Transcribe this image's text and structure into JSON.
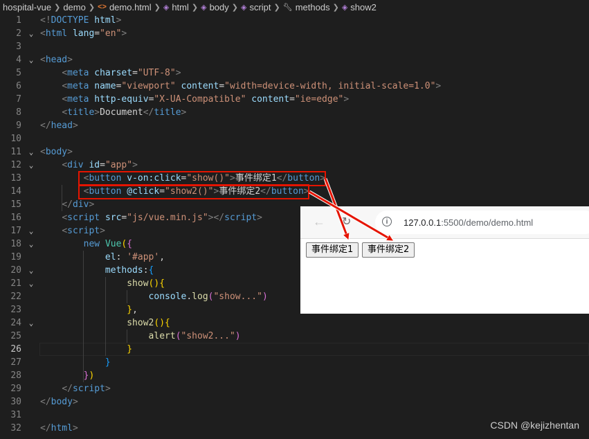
{
  "breadcrumb": [
    "hospital-vue",
    "demo",
    "demo.html",
    "html",
    "body",
    "script",
    "methods",
    "show2"
  ],
  "editor": {
    "active_line": 26,
    "lines": [
      {
        "n": 1,
        "fold": "",
        "segs": [
          [
            "br",
            "<!"
          ],
          [
            "tag",
            "DOCTYPE"
          ],
          [
            "txt",
            " "
          ],
          [
            "attr",
            "html"
          ],
          [
            "br",
            ">"
          ]
        ]
      },
      {
        "n": 2,
        "fold": "v",
        "segs": [
          [
            "br",
            "<"
          ],
          [
            "tag",
            "html"
          ],
          [
            "txt",
            " "
          ],
          [
            "attr",
            "lang"
          ],
          [
            "txt",
            "="
          ],
          [
            "str",
            "\"en\""
          ],
          [
            "br",
            ">"
          ]
        ]
      },
      {
        "n": 3,
        "fold": "",
        "segs": []
      },
      {
        "n": 4,
        "fold": "v",
        "segs": [
          [
            "br",
            "<"
          ],
          [
            "tag",
            "head"
          ],
          [
            "br",
            ">"
          ]
        ]
      },
      {
        "n": 5,
        "fold": "",
        "segs": [
          [
            "txt",
            "    "
          ],
          [
            "br",
            "<"
          ],
          [
            "tag",
            "meta"
          ],
          [
            "txt",
            " "
          ],
          [
            "attr",
            "charset"
          ],
          [
            "txt",
            "="
          ],
          [
            "str",
            "\"UTF-8\""
          ],
          [
            "br",
            ">"
          ]
        ]
      },
      {
        "n": 6,
        "fold": "",
        "segs": [
          [
            "txt",
            "    "
          ],
          [
            "br",
            "<"
          ],
          [
            "tag",
            "meta"
          ],
          [
            "txt",
            " "
          ],
          [
            "attr",
            "name"
          ],
          [
            "txt",
            "="
          ],
          [
            "str",
            "\"viewport\""
          ],
          [
            "txt",
            " "
          ],
          [
            "attr",
            "content"
          ],
          [
            "txt",
            "="
          ],
          [
            "str",
            "\"width=device-width, initial-scale=1.0\""
          ],
          [
            "br",
            ">"
          ]
        ]
      },
      {
        "n": 7,
        "fold": "",
        "segs": [
          [
            "txt",
            "    "
          ],
          [
            "br",
            "<"
          ],
          [
            "tag",
            "meta"
          ],
          [
            "txt",
            " "
          ],
          [
            "attr",
            "http-equiv"
          ],
          [
            "txt",
            "="
          ],
          [
            "str",
            "\"X-UA-Compatible\""
          ],
          [
            "txt",
            " "
          ],
          [
            "attr",
            "content"
          ],
          [
            "txt",
            "="
          ],
          [
            "str",
            "\"ie=edge\""
          ],
          [
            "br",
            ">"
          ]
        ]
      },
      {
        "n": 8,
        "fold": "",
        "segs": [
          [
            "txt",
            "    "
          ],
          [
            "br",
            "<"
          ],
          [
            "tag",
            "title"
          ],
          [
            "br",
            ">"
          ],
          [
            "txt",
            "Document"
          ],
          [
            "br",
            "</"
          ],
          [
            "tag",
            "title"
          ],
          [
            "br",
            ">"
          ]
        ]
      },
      {
        "n": 9,
        "fold": "",
        "segs": [
          [
            "br",
            "</"
          ],
          [
            "tag",
            "head"
          ],
          [
            "br",
            ">"
          ]
        ]
      },
      {
        "n": 10,
        "fold": "",
        "segs": []
      },
      {
        "n": 11,
        "fold": "v",
        "segs": [
          [
            "br",
            "<"
          ],
          [
            "tag",
            "body"
          ],
          [
            "br",
            ">"
          ]
        ]
      },
      {
        "n": 12,
        "fold": "v",
        "segs": [
          [
            "txt",
            "    "
          ],
          [
            "br",
            "<"
          ],
          [
            "tag",
            "div"
          ],
          [
            "txt",
            " "
          ],
          [
            "attr",
            "id"
          ],
          [
            "txt",
            "="
          ],
          [
            "str",
            "\"app\""
          ],
          [
            "br",
            ">"
          ]
        ]
      },
      {
        "n": 13,
        "fold": "",
        "segs": [
          [
            "txt",
            "        "
          ],
          [
            "br",
            "<"
          ],
          [
            "tag",
            "button"
          ],
          [
            "txt",
            " "
          ],
          [
            "attr",
            "v-on:click"
          ],
          [
            "txt",
            "="
          ],
          [
            "str",
            "\"show()\""
          ],
          [
            "br",
            ">"
          ],
          [
            "txt",
            "事件绑定1"
          ],
          [
            "br",
            "</"
          ],
          [
            "tag",
            "button"
          ],
          [
            "br",
            ">"
          ]
        ]
      },
      {
        "n": 14,
        "fold": "",
        "segs": [
          [
            "txt",
            "        "
          ],
          [
            "br",
            "<"
          ],
          [
            "tag",
            "button"
          ],
          [
            "txt",
            " "
          ],
          [
            "attr",
            "@click"
          ],
          [
            "txt",
            "="
          ],
          [
            "str",
            "\"show2()\""
          ],
          [
            "br",
            ">"
          ],
          [
            "txt",
            "事件绑定2"
          ],
          [
            "br",
            "</"
          ],
          [
            "tag",
            "button"
          ],
          [
            "br",
            ">"
          ]
        ]
      },
      {
        "n": 15,
        "fold": "",
        "segs": [
          [
            "txt",
            "    "
          ],
          [
            "br",
            "</"
          ],
          [
            "tag",
            "div"
          ],
          [
            "br",
            ">"
          ]
        ]
      },
      {
        "n": 16,
        "fold": "",
        "segs": [
          [
            "txt",
            "    "
          ],
          [
            "br",
            "<"
          ],
          [
            "tag",
            "script"
          ],
          [
            "txt",
            " "
          ],
          [
            "attr",
            "src"
          ],
          [
            "txt",
            "="
          ],
          [
            "str",
            "\"js/vue.min.js\""
          ],
          [
            "br",
            "></"
          ],
          [
            "tag",
            "script"
          ],
          [
            "br",
            ">"
          ]
        ]
      },
      {
        "n": 17,
        "fold": "v",
        "segs": [
          [
            "txt",
            "    "
          ],
          [
            "br",
            "<"
          ],
          [
            "tag",
            "script"
          ],
          [
            "br",
            ">"
          ]
        ]
      },
      {
        "n": 18,
        "fold": "v",
        "segs": [
          [
            "txt",
            "        "
          ],
          [
            "kw",
            "new"
          ],
          [
            "txt",
            " "
          ],
          [
            "cls",
            "Vue"
          ],
          [
            "b1",
            "("
          ],
          [
            "b2",
            "{"
          ]
        ]
      },
      {
        "n": 19,
        "fold": "",
        "segs": [
          [
            "txt",
            "            "
          ],
          [
            "var",
            "el"
          ],
          [
            "txt",
            ": "
          ],
          [
            "str",
            "'#app'"
          ],
          [
            "txt",
            ","
          ]
        ]
      },
      {
        "n": 20,
        "fold": "v",
        "segs": [
          [
            "txt",
            "            "
          ],
          [
            "var",
            "methods"
          ],
          [
            "txt",
            ":"
          ],
          [
            "b3",
            "{"
          ]
        ]
      },
      {
        "n": 21,
        "fold": "v",
        "segs": [
          [
            "txt",
            "                "
          ],
          [
            "fn",
            "show"
          ],
          [
            "b1",
            "()"
          ],
          [
            "b1",
            "{"
          ]
        ]
      },
      {
        "n": 22,
        "fold": "",
        "segs": [
          [
            "txt",
            "                    "
          ],
          [
            "var",
            "console"
          ],
          [
            "txt",
            "."
          ],
          [
            "fn",
            "log"
          ],
          [
            "b2",
            "("
          ],
          [
            "str",
            "\"show...\""
          ],
          [
            "b2",
            ")"
          ]
        ]
      },
      {
        "n": 23,
        "fold": "",
        "segs": [
          [
            "txt",
            "                "
          ],
          [
            "b1",
            "}"
          ],
          [
            "txt",
            ","
          ]
        ]
      },
      {
        "n": 24,
        "fold": "v",
        "segs": [
          [
            "txt",
            "                "
          ],
          [
            "fn",
            "show2"
          ],
          [
            "b1",
            "()"
          ],
          [
            "b1",
            "{"
          ]
        ]
      },
      {
        "n": 25,
        "fold": "",
        "segs": [
          [
            "txt",
            "                    "
          ],
          [
            "fn",
            "alert"
          ],
          [
            "b2",
            "("
          ],
          [
            "str",
            "\"show2...\""
          ],
          [
            "b2",
            ")"
          ]
        ]
      },
      {
        "n": 26,
        "fold": "",
        "segs": [
          [
            "txt",
            "                "
          ],
          [
            "b1",
            "}"
          ]
        ]
      },
      {
        "n": 27,
        "fold": "",
        "segs": [
          [
            "txt",
            "            "
          ],
          [
            "b3",
            "}"
          ]
        ]
      },
      {
        "n": 28,
        "fold": "",
        "segs": [
          [
            "txt",
            "        "
          ],
          [
            "b2",
            "}"
          ],
          [
            "b1",
            ")"
          ]
        ]
      },
      {
        "n": 29,
        "fold": "",
        "segs": [
          [
            "txt",
            "    "
          ],
          [
            "br",
            "</"
          ],
          [
            "tag",
            "script"
          ],
          [
            "br",
            ">"
          ]
        ]
      },
      {
        "n": 30,
        "fold": "",
        "segs": [
          [
            "br",
            "</"
          ],
          [
            "tag",
            "body"
          ],
          [
            "br",
            ">"
          ]
        ]
      },
      {
        "n": 31,
        "fold": "",
        "segs": []
      },
      {
        "n": 32,
        "fold": "",
        "segs": [
          [
            "br",
            "</"
          ],
          [
            "tag",
            "html"
          ],
          [
            "br",
            ">"
          ]
        ]
      }
    ]
  },
  "browser": {
    "url_host": "127.0.0.1",
    "url_path": ":5500/demo/demo.html",
    "button1": "事件绑定1",
    "button2": "事件绑定2"
  },
  "watermark": "CSDN @kejizhentan",
  "colors": {
    "highlight_box": "#e51400",
    "arrow": "#e51400"
  }
}
